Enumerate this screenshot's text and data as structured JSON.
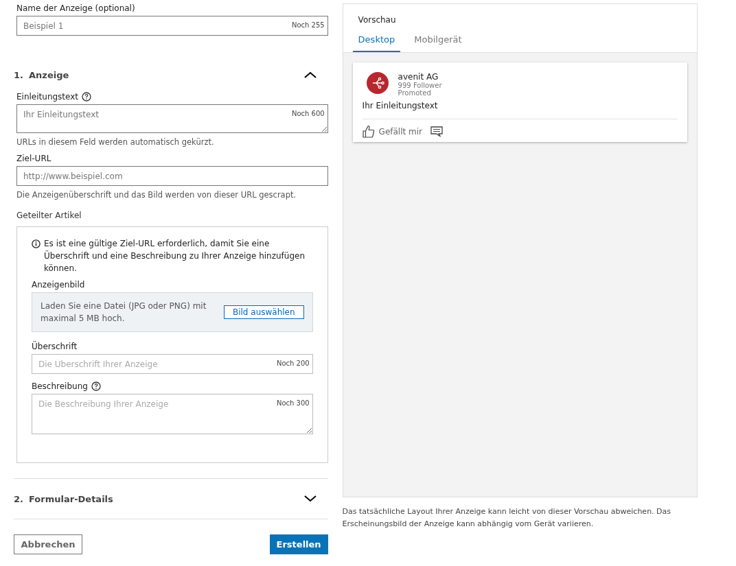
{
  "ad_name": {
    "label": "Name der Anzeige (optional)",
    "placeholder": "Beispiel 1",
    "counter": "Noch 255"
  },
  "sections": [
    {
      "number": "1.",
      "title": "Anzeige",
      "expanded": true
    },
    {
      "number": "2.",
      "title": "Formular-Details",
      "expanded": false
    }
  ],
  "intro_text": {
    "label": "Einleitungstext",
    "placeholder": "Ihr Einleitungstext",
    "counter": "Noch 600",
    "hint": "URLs in diesem Feld werden automatisch gekürzt."
  },
  "target_url": {
    "label": "Ziel-URL",
    "placeholder": "http://www.beispiel.com",
    "hint": "Die Anzeigenüberschrift und das Bild werden von dieser URL gescrapt."
  },
  "shared_article": {
    "label": "Geteilter Artikel",
    "info": "Es ist eine gültige Ziel-URL erforderlich, damit Sie eine Überschrift und eine Beschreibung zu Ihrer Anzeige hinzufügen können.",
    "image": {
      "label": "Anzeigenbild",
      "text": "Laden Sie eine Datei (JPG oder PNG) mit maximal 5 MB hoch.",
      "button": "Bild auswählen"
    },
    "headline": {
      "label": "Überschrift",
      "placeholder": "Die Überschrift Ihrer Anzeige",
      "counter": "Noch 200"
    },
    "description": {
      "label": "Beschreibung",
      "placeholder": "Die Beschreibung Ihrer Anzeige",
      "counter": "Noch 300"
    }
  },
  "buttons": {
    "cancel": "Abbrechen",
    "create": "Erstellen"
  },
  "preview": {
    "title": "Vorschau",
    "tabs": [
      {
        "label": "Desktop",
        "selected": true
      },
      {
        "label": "Mobilgerät",
        "selected": false
      }
    ],
    "post": {
      "company": "avenit AG",
      "followers": "999 Follower",
      "promoted": "Promoted",
      "text": "Ihr Einleitungstext",
      "like": "Gefällt mir"
    },
    "note": "Das tatsächliche Layout Ihrer Anzeige kann leicht von dieser Vorschau abweichen. Das Erscheinungsbild der Anzeige kann abhängig vom Gerät variieren."
  }
}
